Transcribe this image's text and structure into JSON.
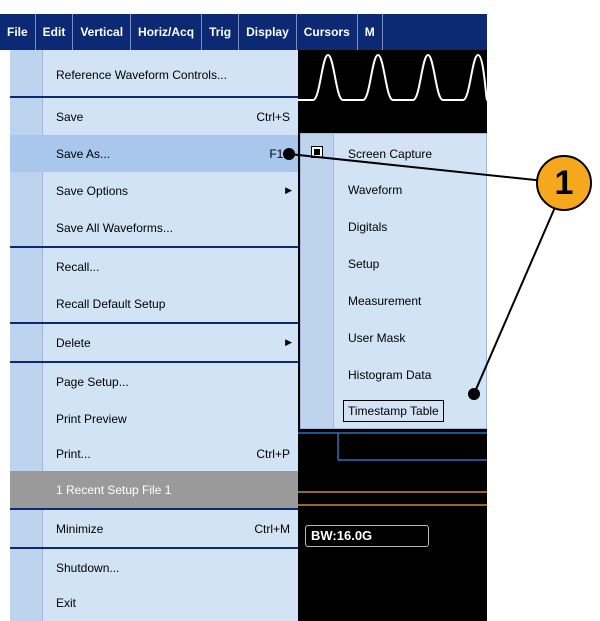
{
  "menubar": {
    "items": [
      "File",
      "Edit",
      "Vertical",
      "Horiz/Acq",
      "Trig",
      "Display",
      "Cursors",
      "M"
    ]
  },
  "file_menu": {
    "items": [
      {
        "label": "Reference Waveform Controls...",
        "shortcut": ""
      },
      {
        "label": "Save",
        "shortcut": "Ctrl+S"
      },
      {
        "label": "Save As...",
        "shortcut": "F12"
      },
      {
        "label": "Save Options",
        "shortcut": ""
      },
      {
        "label": "Save All Waveforms...",
        "shortcut": ""
      },
      {
        "label": "Recall...",
        "shortcut": ""
      },
      {
        "label": "Recall Default Setup",
        "shortcut": ""
      },
      {
        "label": "Delete",
        "shortcut": ""
      },
      {
        "label": "Page Setup...",
        "shortcut": ""
      },
      {
        "label": "Print Preview",
        "shortcut": ""
      },
      {
        "label": "Print...",
        "shortcut": "Ctrl+P"
      },
      {
        "label": "1 Recent Setup File 1",
        "shortcut": ""
      },
      {
        "label": "Minimize",
        "shortcut": "Ctrl+M"
      },
      {
        "label": "Shutdown...",
        "shortcut": ""
      },
      {
        "label": "Exit",
        "shortcut": ""
      }
    ]
  },
  "save_as_submenu": {
    "items": [
      "Screen Capture",
      "Waveform",
      "Digitals",
      "Setup",
      "Measurement",
      "User Mask",
      "Histogram Data",
      "Timestamp Table"
    ]
  },
  "scope": {
    "bandwidth_readout": "BW:16.0G"
  },
  "callout": {
    "number": "1",
    "color": "#f5a81c"
  },
  "colors": {
    "menubar": "#0b2a73",
    "menu_bg": "#d2e3f5",
    "highlight": "#a9c7ec",
    "selected_gray": "#9a9a9a"
  }
}
